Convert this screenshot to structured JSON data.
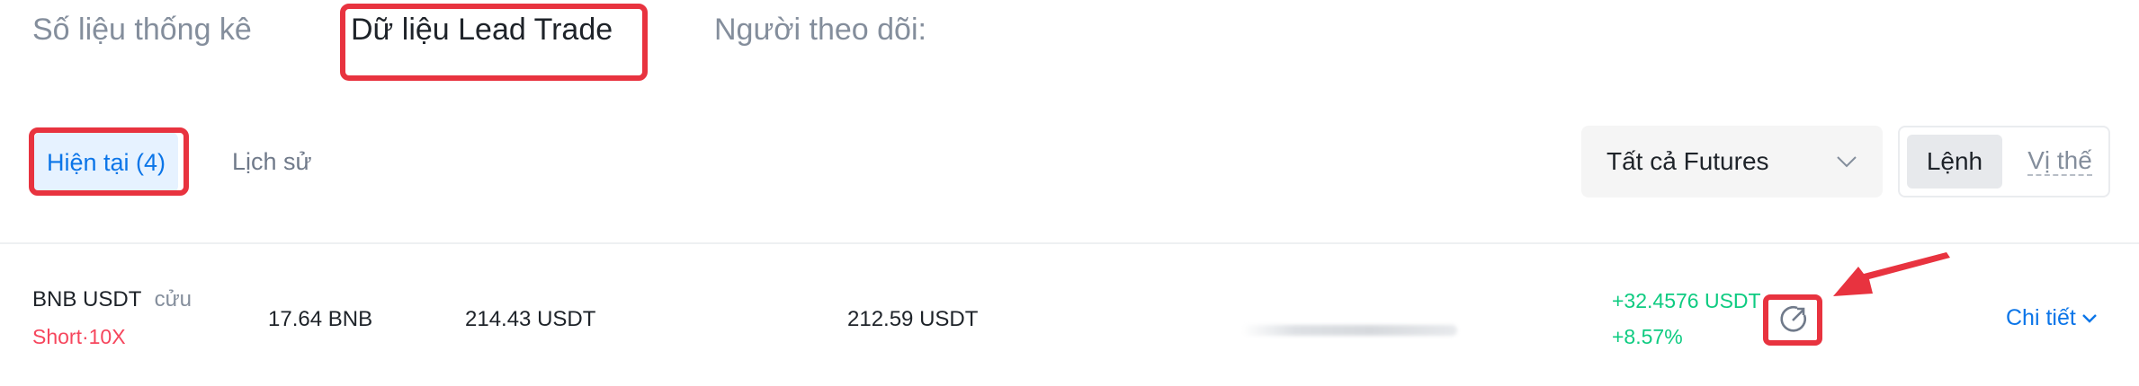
{
  "top_tabs": [
    {
      "label": "Số liệu thống kê",
      "active": false
    },
    {
      "label": "Dữ liệu Lead Trade",
      "active": true
    },
    {
      "label": "Người theo dõi:",
      "active": false
    }
  ],
  "sub_tabs": [
    {
      "label": "Hiện tại (4)",
      "active": true
    },
    {
      "label": "Lịch sử",
      "active": false
    }
  ],
  "filter": {
    "selected": "Tất cả Futures"
  },
  "view_toggle": [
    {
      "label": "Lệnh",
      "active": true
    },
    {
      "label": "Vị thế",
      "active": false
    }
  ],
  "position_row": {
    "symbol": "BNB USDT",
    "margin_mode": "cửu",
    "side_leverage": "Short·10X",
    "size": "17.64 BNB",
    "entry_price": "214.43 USDT",
    "mark_price": "212.59 USDT",
    "pnl_amount": "+32.4576 USDT",
    "pnl_percent": "+8.57%",
    "detail_label": "Chi tiết"
  },
  "colors": {
    "highlight_red": "#e8333f",
    "accent_blue": "#0b75e8",
    "profit_green": "#0ecb81",
    "short_red": "#f6465d"
  },
  "icons": [
    "share-icon",
    "chevron-down-icon",
    "arrow-annotation"
  ]
}
